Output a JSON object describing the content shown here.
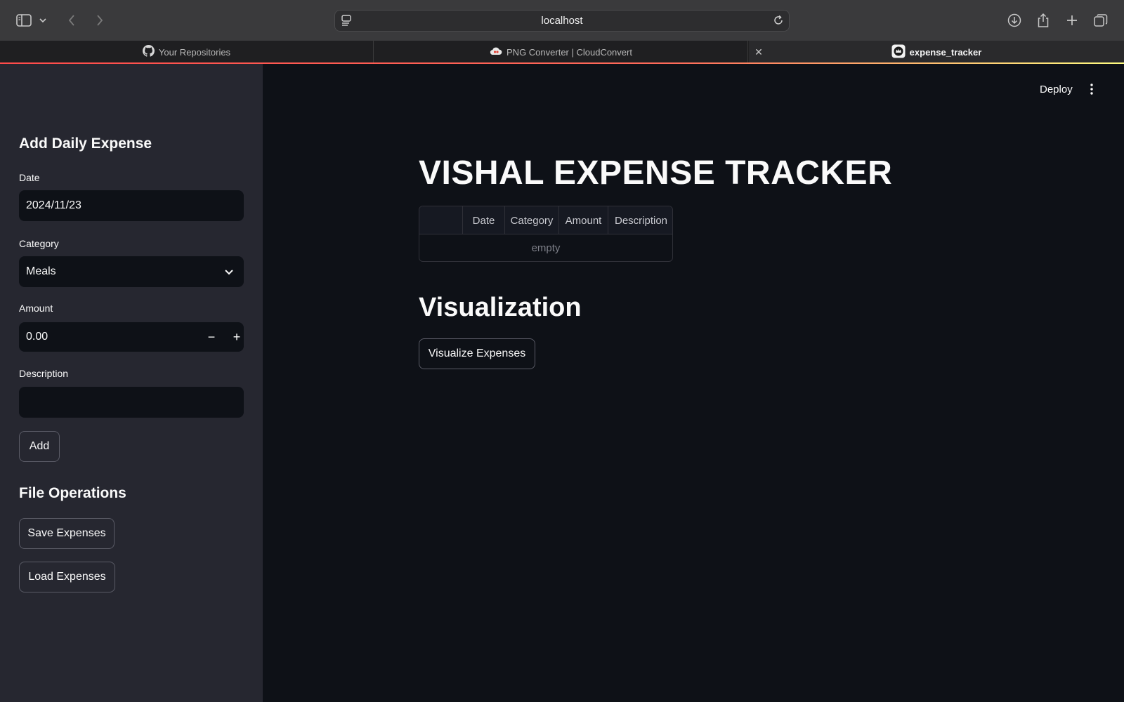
{
  "browser": {
    "address": "localhost",
    "tabs": [
      {
        "label": "Your Repositories",
        "icon": "github-icon"
      },
      {
        "label": "PNG Converter | CloudConvert",
        "icon": "cloudconvert-icon"
      },
      {
        "label": "expense_tracker",
        "icon": "streamlit-icon",
        "active": true
      }
    ]
  },
  "sidebar": {
    "section1_title": "Add Daily Expense",
    "date": {
      "label": "Date",
      "value": "2024/11/23"
    },
    "category": {
      "label": "Category",
      "value": "Meals"
    },
    "amount": {
      "label": "Amount",
      "value": "0.00",
      "minus": "−",
      "plus": "+"
    },
    "description": {
      "label": "Description",
      "value": ""
    },
    "add_button": "Add",
    "section2_title": "File Operations",
    "save_button": "Save Expenses",
    "load_button": "Load Expenses"
  },
  "main": {
    "deploy": "Deploy",
    "title": "VISHAL EXPENSE TRACKER",
    "table": {
      "columns": [
        "",
        "Date",
        "Category",
        "Amount",
        "Description"
      ],
      "empty_text": "empty"
    },
    "viz_title": "Visualization",
    "viz_button": "Visualize Expenses"
  },
  "colors": {
    "sidebar_bg": "#262730",
    "main_bg": "#0e1117",
    "accent": "#ff4b4b"
  }
}
